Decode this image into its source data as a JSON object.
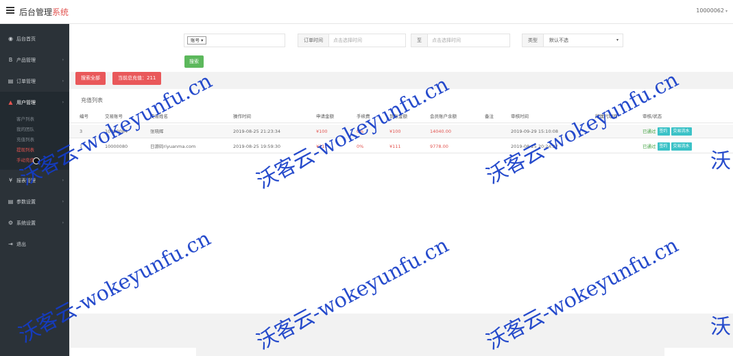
{
  "header": {
    "title_main": "后台管理",
    "title_accent": "系统",
    "user_id": "10000062",
    "user_caret": "▾"
  },
  "sidebar": {
    "items": [
      {
        "label": "后台首页",
        "icon": "dashboard-icon",
        "glyph": "◉"
      },
      {
        "label": "产品管理",
        "icon": "product-icon",
        "glyph": "B"
      },
      {
        "label": "订单管理",
        "icon": "order-icon",
        "glyph": "▤"
      },
      {
        "label": "用户管理",
        "icon": "user-icon",
        "glyph": "▲"
      },
      {
        "label": "报表管理",
        "icon": "yen-icon",
        "glyph": "¥"
      },
      {
        "label": "参数设置",
        "icon": "settings-icon",
        "glyph": "▤"
      },
      {
        "label": "系统设置",
        "icon": "gear-icon",
        "glyph": "⚙"
      },
      {
        "label": "退出",
        "icon": "logout-icon",
        "glyph": "⇥"
      }
    ],
    "arrow": "›",
    "submenu": [
      "客户列表",
      "我的团队",
      "充值列表",
      "提现列表",
      "手动充值"
    ]
  },
  "filters": {
    "select_mini": "账号 ▾",
    "order_time_label": "订单时间",
    "order_time_placeholder": "点击选择时间",
    "second_time_label": "至",
    "second_time_placeholder": "点击选择时间",
    "type_label": "类型",
    "type_value": "默认不选",
    "type_caret": "▾",
    "search_button": "搜索"
  },
  "actions": {
    "search_all": "搜索全部",
    "second_button": "当前总充值：211"
  },
  "table": {
    "title": "充值列表",
    "headers": [
      "编号",
      "交易账号",
      "交易姓名",
      "操作时间",
      "申请金额",
      "手续费",
      "到账金额",
      "会员账户余额",
      "备注",
      "审核时间",
      "所属代理商",
      "审核/状态"
    ],
    "rows": [
      {
        "id": "3",
        "account": "10000084",
        "name": "张晓辉",
        "op_time": "2019-08-25 21:23:34",
        "apply": "¥100",
        "fee": "0%",
        "arrive": "¥100",
        "balance": "14040.00",
        "remark": "",
        "audit_time": "2019-09-29 15:10:08",
        "agent": "",
        "status": "已通过",
        "tag1": "签约",
        "tag2": "交易流水"
      },
      {
        "id": "1",
        "account": "10000080",
        "name": "日源码riyuanma.com",
        "op_time": "2019-08-25 19:59:30",
        "apply": "¥111",
        "fee": "0%",
        "arrive": "¥111",
        "balance": "9778.00",
        "remark": "",
        "audit_time": "2019-08-25 20:24:37",
        "agent": "",
        "status": "已通过",
        "tag1": "签约",
        "tag2": "交易流水"
      }
    ]
  },
  "watermark": "沃客云-wokeyunfu.cn",
  "watermark_partial": "沃"
}
